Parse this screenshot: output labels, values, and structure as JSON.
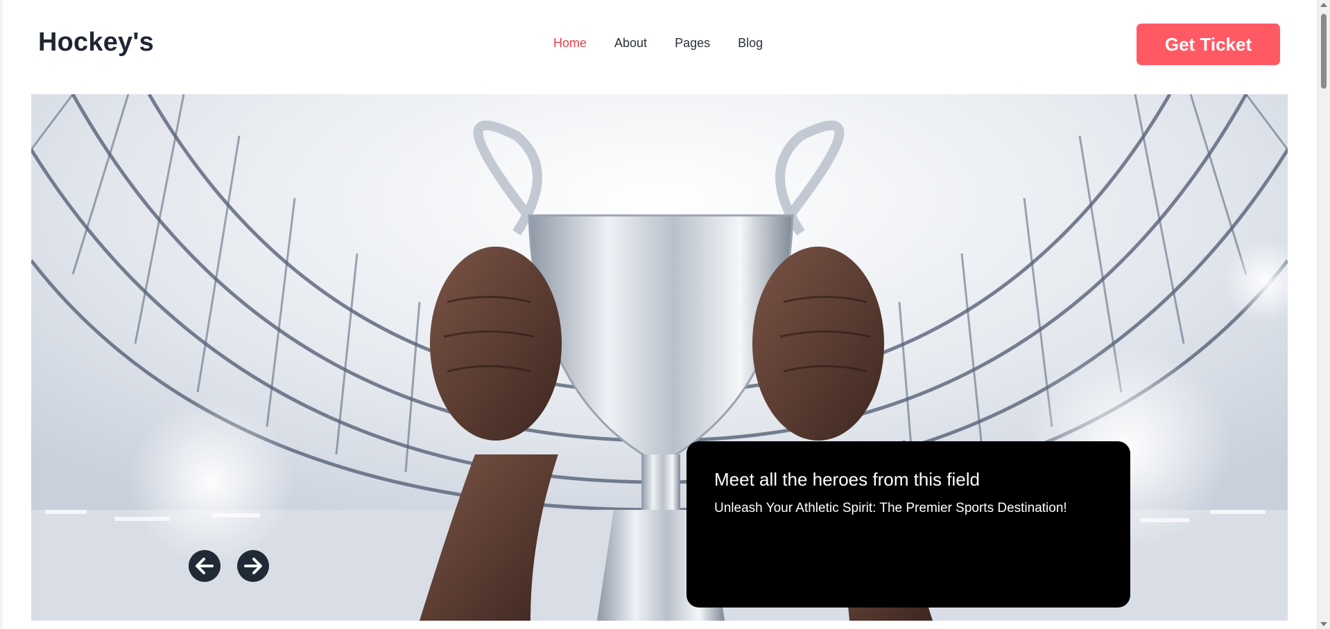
{
  "brand": {
    "name": "Hockey's"
  },
  "nav": {
    "items": [
      {
        "label": "Home",
        "active": true
      },
      {
        "label": "About",
        "active": false
      },
      {
        "label": "Pages",
        "active": false
      },
      {
        "label": "Blog",
        "active": false
      }
    ]
  },
  "cta": {
    "label": "Get Ticket",
    "color": "#ff5a64"
  },
  "hero": {
    "image_icon": "trophy-stadium-image",
    "caption_title": "Meet all the heroes from this field",
    "caption_subtitle": "Unleash Your Athletic Spirit: The Premier Sports Destination!",
    "prev_icon": "arrow-left-icon",
    "next_icon": "arrow-right-icon"
  },
  "colors": {
    "accent": "#e8404b",
    "dark": "#1f2633",
    "caption_bg": "#000000"
  }
}
